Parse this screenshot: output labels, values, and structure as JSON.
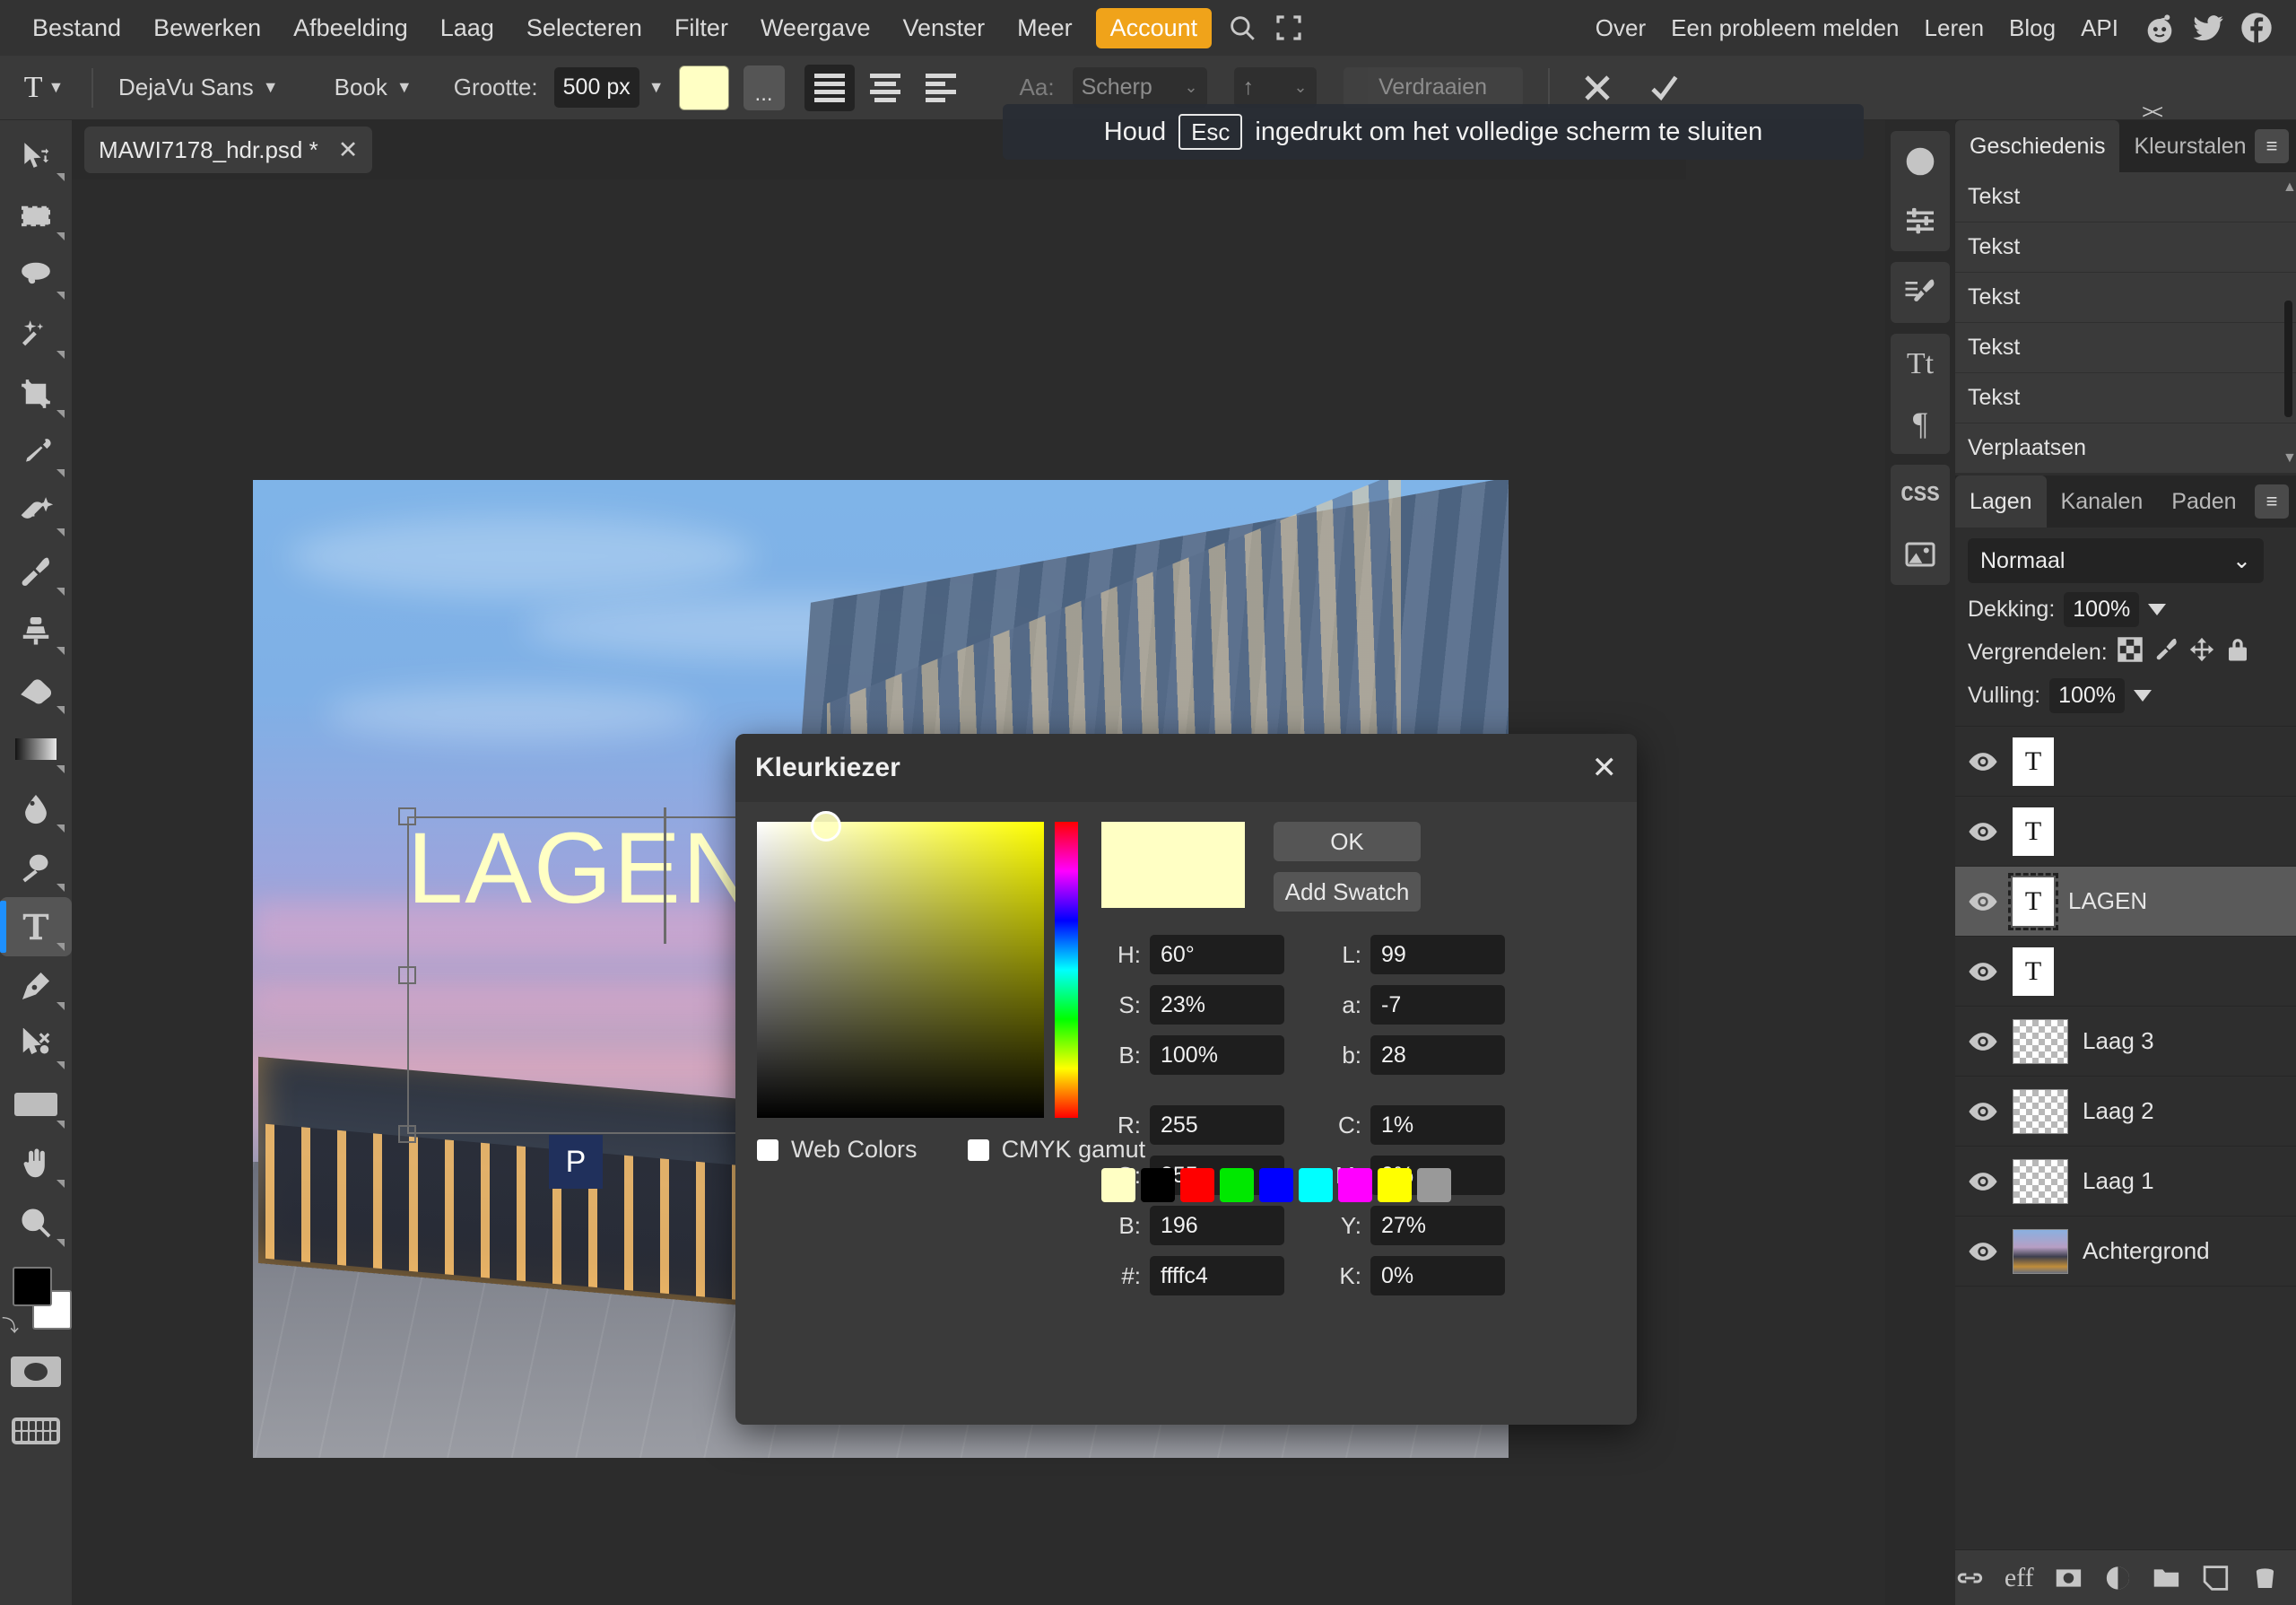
{
  "menubar": {
    "items": [
      "Bestand",
      "Bewerken",
      "Afbeelding",
      "Laag",
      "Selecteren",
      "Filter",
      "Weergave",
      "Venster",
      "Meer"
    ],
    "account_label": "Account",
    "search_icon": "search-icon",
    "fullscreen_icon": "fullscreen-icon",
    "right_items": [
      "Over",
      "Een probleem melden",
      "Leren",
      "Blog",
      "API"
    ],
    "social": [
      "reddit-icon",
      "twitter-icon",
      "facebook-icon"
    ],
    "accent_color": "#f0a31a"
  },
  "options_bar": {
    "tool_icon": "text-tool-icon",
    "font_family": "DejaVu Sans",
    "font_style": "Book",
    "size_label": "Grootte:",
    "size_value": "500 px",
    "color_chip": "#ffffc4",
    "more_label": "...",
    "align_icons": [
      "align-left-icon",
      "align-center-icon",
      "align-right-icon"
    ],
    "aa_label": "Aa:",
    "aa_value": "Scherp",
    "orientation_value": "↑",
    "warp_label": "Verdraaien",
    "cancel_icon": "cancel-x-icon",
    "commit_icon": "commit-check-icon"
  },
  "toolbar": {
    "tools": [
      {
        "name": "move-tool",
        "icon": "move-icon"
      },
      {
        "name": "rect-select-tool",
        "icon": "marquee-icon"
      },
      {
        "name": "lasso-tool",
        "icon": "lasso-icon"
      },
      {
        "name": "magic-wand-tool",
        "icon": "magic-wand-icon"
      },
      {
        "name": "crop-tool",
        "icon": "crop-icon"
      },
      {
        "name": "eyedropper-tool",
        "icon": "eyedropper-icon"
      },
      {
        "name": "heal-tool",
        "icon": "heal-icon"
      },
      {
        "name": "brush-tool",
        "icon": "brush-icon"
      },
      {
        "name": "clone-stamp-tool",
        "icon": "stamp-icon"
      },
      {
        "name": "eraser-tool",
        "icon": "eraser-icon"
      },
      {
        "name": "gradient-tool",
        "icon": "gradient-icon"
      },
      {
        "name": "blur-tool",
        "icon": "blur-drop-icon"
      },
      {
        "name": "dodge-tool",
        "icon": "dodge-icon"
      },
      {
        "name": "type-tool",
        "icon": "type-T-icon",
        "active": true
      },
      {
        "name": "pen-tool",
        "icon": "pen-icon"
      },
      {
        "name": "path-select-tool",
        "icon": "path-select-icon"
      },
      {
        "name": "shape-tool",
        "icon": "rectangle-icon"
      },
      {
        "name": "hand-tool",
        "icon": "hand-icon"
      },
      {
        "name": "zoom-tool",
        "icon": "magnifier-icon"
      }
    ],
    "foreground_color": "#000000",
    "background_color": "#ffffff",
    "quickmask_icon": "quick-mask-icon",
    "keyboard_icon": "keyboard-icon"
  },
  "document": {
    "tab_name": "MAWI7178_hdr.psd *",
    "close_icon": "close-icon",
    "canvas_text": "LAGEN",
    "canvas_text_color": "#ffffc4"
  },
  "fullscreen_hint": {
    "before": "Houd",
    "key": "Esc",
    "after": "ingedrukt om het volledige scherm te sluiten"
  },
  "rail": {
    "groups": [
      [
        "info-icon",
        "adjustments-icon"
      ],
      [
        "brush-settings-icon"
      ],
      [
        "character-icon",
        "paragraph-icon"
      ],
      [
        "css-icon",
        "image-icon"
      ]
    ]
  },
  "history_panel": {
    "tabs": [
      {
        "label": "Geschiedenis",
        "active": true
      },
      {
        "label": "Kleurstalen",
        "active": false
      }
    ],
    "menu_icon": "panel-menu-icon",
    "collapse_icon": "collapse-icon",
    "items": [
      "Tekst",
      "Tekst",
      "Tekst",
      "Tekst",
      "Tekst",
      "Verplaatsen"
    ]
  },
  "layers_panel": {
    "tabs": [
      {
        "label": "Lagen",
        "active": true
      },
      {
        "label": "Kanalen",
        "active": false
      },
      {
        "label": "Paden",
        "active": false
      }
    ],
    "menu_icon": "panel-menu-icon",
    "blend_mode": "Normaal",
    "opacity_label": "Dekking:",
    "opacity_value": "100%",
    "lock_label": "Vergrendelen:",
    "lock_icons": [
      "lock-transparency-icon",
      "lock-paint-icon",
      "lock-move-icon",
      "lock-all-icon"
    ],
    "fill_label": "Vulling:",
    "fill_value": "100%",
    "layers": [
      {
        "name": "",
        "type": "text",
        "visible": true,
        "selected": false
      },
      {
        "name": "",
        "type": "text",
        "visible": true,
        "selected": false
      },
      {
        "name": "LAGEN",
        "type": "text",
        "visible": true,
        "selected": true
      },
      {
        "name": "",
        "type": "text",
        "visible": true,
        "selected": false
      },
      {
        "name": "Laag 3",
        "type": "transparent",
        "visible": true,
        "selected": false
      },
      {
        "name": "Laag 2",
        "type": "transparent",
        "visible": true,
        "selected": false
      },
      {
        "name": "Laag 1",
        "type": "transparent",
        "visible": true,
        "selected": false
      },
      {
        "name": "Achtergrond",
        "type": "image",
        "visible": true,
        "selected": false
      }
    ],
    "bottom_icons": [
      "link-layers-icon",
      "layer-effects-icon",
      "layer-mask-icon",
      "adjustment-layer-icon",
      "new-group-icon",
      "new-layer-icon",
      "delete-layer-icon"
    ]
  },
  "color_picker": {
    "title": "Kleurkiezer",
    "close_icon": "close-icon",
    "ok_label": "OK",
    "add_swatch_label": "Add Swatch",
    "preview_color": "#ffffc4",
    "fields_left": [
      {
        "label": "H:",
        "value": "60°"
      },
      {
        "label": "S:",
        "value": "23%"
      },
      {
        "label": "B:",
        "value": "100%"
      },
      {
        "label": "R:",
        "value": "255"
      },
      {
        "label": "G:",
        "value": "255"
      },
      {
        "label": "B:",
        "value": "196"
      },
      {
        "label": "#:",
        "value": "ffffc4"
      }
    ],
    "fields_right": [
      {
        "label": "L:",
        "value": "99"
      },
      {
        "label": "a:",
        "value": "-7"
      },
      {
        "label": "b:",
        "value": "28"
      },
      {
        "label": "C:",
        "value": "1%"
      },
      {
        "label": "M:",
        "value": "0%"
      },
      {
        "label": "Y:",
        "value": "27%"
      },
      {
        "label": "K:",
        "value": "0%"
      }
    ],
    "web_colors_label": "Web Colors",
    "web_colors_checked": false,
    "cmyk_gamut_label": "CMYK gamut",
    "cmyk_gamut_checked": false,
    "swatches": [
      "#ffffc4",
      "#000000",
      "#ff0000",
      "#00e800",
      "#0000ff",
      "#00ffff",
      "#ff00ff",
      "#ffff00",
      "#999999"
    ]
  }
}
